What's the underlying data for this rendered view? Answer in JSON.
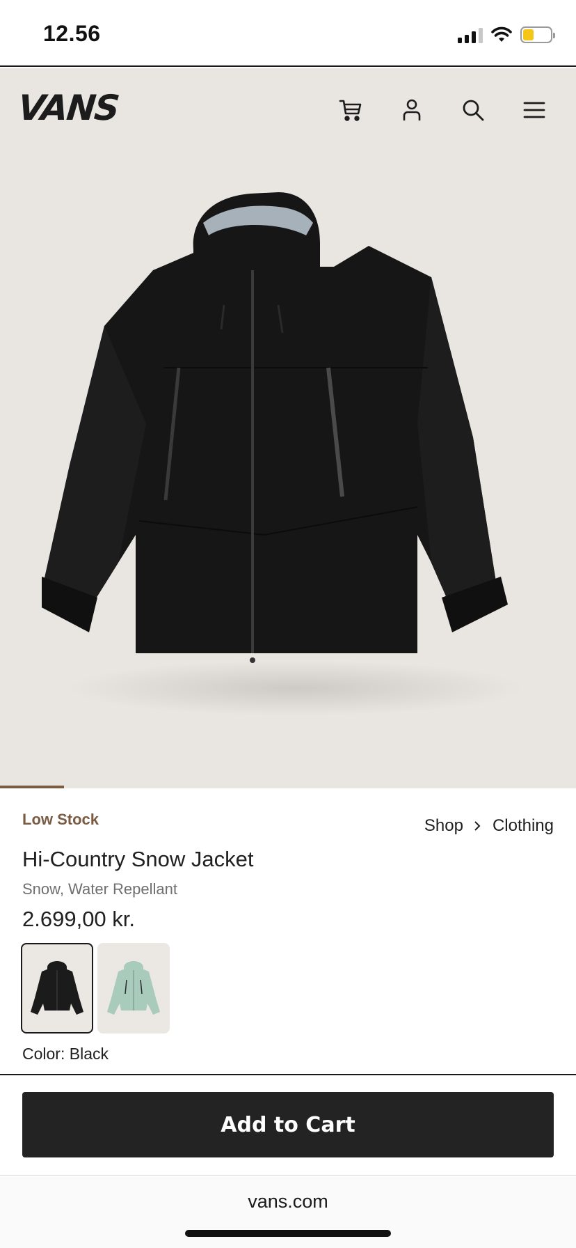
{
  "status_bar": {
    "time": "12.56",
    "battery_color": "#f5c518"
  },
  "header": {
    "logo": "VANS",
    "icons": [
      "cart-icon",
      "account-icon",
      "search-icon",
      "menu-icon"
    ]
  },
  "product": {
    "stock_status": "Low Stock",
    "breadcrumb": [
      "Shop",
      "Clothing"
    ],
    "title": "Hi-Country Snow Jacket",
    "subtitle": "Snow, Water Repellant",
    "price": "2.699,00 kr.",
    "color_label": "Color: Black",
    "swatches": [
      {
        "color": "black",
        "hex": "#1b1b1b",
        "selected": true
      },
      {
        "color": "mint",
        "hex": "#a9cbbb",
        "selected": false
      }
    ]
  },
  "cart": {
    "button_label": "Add to Cart"
  },
  "browser": {
    "url": "vans.com"
  },
  "colors": {
    "accent_brown": "#7a5c45",
    "button_dark": "#232323",
    "hero_bg": "#e9e6e1"
  }
}
